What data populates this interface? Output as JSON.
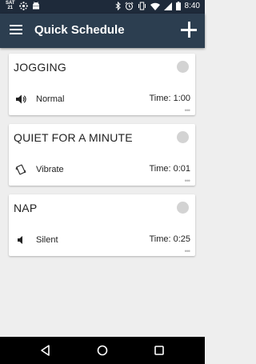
{
  "status_bar": {
    "date_day": "SAT",
    "date_num": "21",
    "time": "8:40",
    "left_icons": [
      "calendar-icon",
      "settings-dots-icon",
      "android-icon"
    ],
    "right_icons": [
      "bluetooth-icon",
      "alarm-icon",
      "vibrate-icon",
      "wifi-icon",
      "signal-icon",
      "battery-icon"
    ]
  },
  "app_bar": {
    "title": "Quick Schedule",
    "menu_icon": "hamburger-icon",
    "add_icon": "plus-icon",
    "background": "#2c3e50"
  },
  "schedules": [
    {
      "title": "JOGGING",
      "mode": "Normal",
      "mode_icon": "volume-up-icon",
      "time": "Time: 1:00"
    },
    {
      "title": "QUIET FOR A MINUTE",
      "mode": "Vibrate",
      "mode_icon": "vibrate-icon",
      "time": "Time: 0:01"
    },
    {
      "title": "NAP",
      "mode": "Silent",
      "mode_icon": "volume-mute-icon",
      "time": "Time: 0:25"
    }
  ],
  "nav_bar": {
    "buttons": [
      "back-icon",
      "home-icon",
      "recents-icon"
    ]
  }
}
